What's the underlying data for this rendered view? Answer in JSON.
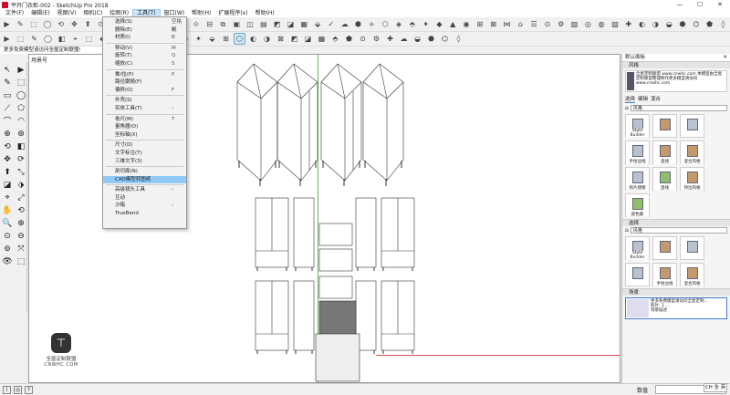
{
  "window": {
    "title": "平开门衣柜-002 - SketchUp Pro 2018",
    "minimize": "—",
    "maximize": "☐",
    "close": "✕"
  },
  "menubar": {
    "items": [
      "文件(F)",
      "编辑(E)",
      "视图(V)",
      "相机(C)",
      "绘图(R)",
      "工具(T)",
      "窗口(W)",
      "帮助(H)",
      "扩展程序(x)",
      "帮助(H)"
    ],
    "active_index": 5
  },
  "scene_bar": {
    "info": "更多免费模型请访问全屋定制联盟!",
    "viewport_label": "场景号"
  },
  "tools_menu": {
    "items": [
      {
        "label": "选择(S)",
        "shortcut": "空格键"
      },
      {
        "label": "删除(E)",
        "shortcut": "E"
      },
      {
        "label": "材质(I)",
        "shortcut": "B"
      },
      {
        "sep": true
      },
      {
        "label": "移动(V)",
        "shortcut": "M"
      },
      {
        "label": "旋转(T)",
        "shortcut": "Q"
      },
      {
        "label": "缩放(C)",
        "shortcut": "S"
      },
      {
        "sep": true
      },
      {
        "label": "推/拉(P)",
        "shortcut": "P"
      },
      {
        "label": "路径跟随(F)",
        "shortcut": ""
      },
      {
        "label": "偏移(O)",
        "shortcut": "F"
      },
      {
        "sep": true
      },
      {
        "label": "外壳(S)",
        "shortcut": ""
      },
      {
        "label": "实体工具(T)",
        "shortcut": "›"
      },
      {
        "sep": true
      },
      {
        "label": "卷尺(M)",
        "shortcut": "T"
      },
      {
        "label": "量角器(O)",
        "shortcut": ""
      },
      {
        "label": "坐标轴(X)",
        "shortcut": ""
      },
      {
        "sep": true
      },
      {
        "label": "尺寸(D)",
        "shortcut": ""
      },
      {
        "label": "文字标注(T)",
        "shortcut": ""
      },
      {
        "label": "三维文字(3)",
        "shortcut": ""
      },
      {
        "sep": true
      },
      {
        "label": "剖切面(N)",
        "shortcut": ""
      },
      {
        "label": "CAD模型转图纸",
        "shortcut": "",
        "highlight": true
      },
      {
        "sep": true
      },
      {
        "label": "高级镜头工具",
        "shortcut": "›"
      },
      {
        "label": "互动",
        "shortcut": ""
      },
      {
        "label": "沙箱",
        "shortcut": "›"
      },
      {
        "label": "TrueBend",
        "shortcut": ""
      }
    ]
  },
  "tray": {
    "title": "默认面板",
    "styles_section": "风格",
    "ad_text": "全屋定制联盟 www.cnwhc.com 本模型由全屋定制联盟整理制作更多模型请访问 www.cnwhc.com",
    "tabs": [
      "选择",
      "编辑",
      "混合"
    ],
    "dropdown_value": "风格",
    "style_names": [
      "Style Builder",
      "",
      "",
      "手绘边线",
      "直线",
      "混合风格",
      "照片建模",
      "直线",
      "持边风格",
      "颜色集"
    ],
    "mix_section": "选择",
    "mix_dropdown_value": "风格",
    "mix_style_names": [
      "Style Builder",
      "",
      "",
      "",
      "手绘边线",
      "混合风格"
    ],
    "scenes_section": "场景",
    "scene_entry_title": "更多免费模型请访问全屋定制...",
    "scene_entry_sub": "照片: 1 ...",
    "scene_entry_desc": "场景描述"
  },
  "status": {
    "measure_label": "数值",
    "ime": "CH 全 英"
  },
  "watermark": {
    "line1": "全屋定制联盟",
    "line2": "CNWHC.COM"
  },
  "colors": {
    "axis_green": "#5cb85c",
    "axis_red": "#d9534f",
    "menu_highlight": "#91c9f7",
    "brand_red": "#c8102e"
  }
}
